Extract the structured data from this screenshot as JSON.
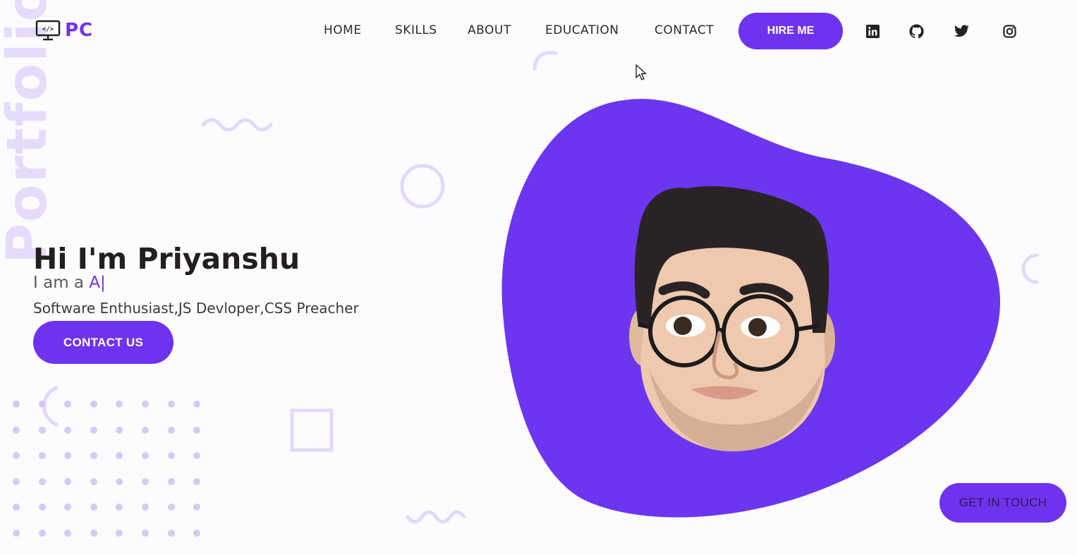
{
  "watermark": "Portfolio",
  "logo": {
    "text": "PC",
    "icon": "monitor-code-icon"
  },
  "nav": {
    "links": [
      "HOME",
      "SKILLS",
      "ABOUT",
      "EDUCATION",
      "CONTACT"
    ],
    "hire_label": "HIRE ME",
    "social_icons": [
      "linkedin-icon",
      "github-icon",
      "twitter-icon",
      "instagram-icon"
    ]
  },
  "hero": {
    "greeting": "Hi I'm Priyanshu",
    "iam_prefix": "I am a ",
    "iam_typed": "A|",
    "tagline": "Software Enthusiast,JS Devloper,CSS Preacher",
    "contact_label": "CONTACT US"
  },
  "cta": {
    "get_in_touch_label": "GET IN TOUCH"
  },
  "colors": {
    "accent": "#6f33f0",
    "decor": "#e3d9fb",
    "background": "#fcfbfe"
  }
}
